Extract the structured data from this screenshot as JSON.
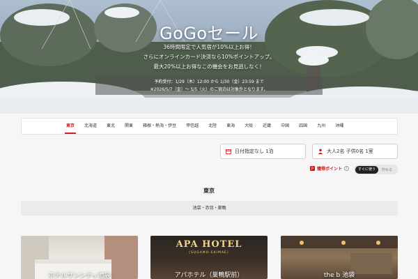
{
  "hero": {
    "title": "GoGoセール",
    "line1": "36時間限定で人気宿が10%以上お得！",
    "line2": "さらにオンラインカード決済なら10%ポイントアップ。",
    "line3": "最大20%以上お得なこの機会をお見逃しなく！",
    "period1": "予約受付：1/29（木）12:00 から 1/30（金）23:59 まで",
    "period2": "※2026/5/7（金）〜 5/5（火）のご宿泊は対象外となります。"
  },
  "regions": [
    "東京",
    "北海道",
    "東北",
    "関東",
    "箱根・熱海・伊豆",
    "甲信越",
    "北陸",
    "東海",
    "大阪",
    "近畿",
    "中国",
    "四国",
    "九州",
    "沖縄"
  ],
  "active_region": "東京",
  "search": {
    "date_label": "日付指定なし 1泊",
    "guest_label": "大人2名 子供0名 1室"
  },
  "points": {
    "label": "獲得ポイント",
    "toggle_on": "すぐに使う",
    "toggle_off": "貯める"
  },
  "section": {
    "title": "東京",
    "area": "池袋・赤羽・巣鴨"
  },
  "hotels": [
    {
      "name": "ホテルサンシティ池袋"
    },
    {
      "name": "アパホテル（巣鴨駅前）",
      "sign": "APA HOTEL",
      "sign_sub": "〈SUGAMO-EKIMAE〉"
    },
    {
      "name": "the b 池袋"
    }
  ],
  "colors": {
    "accent": "#d02020",
    "toggle_active": "#222222"
  }
}
